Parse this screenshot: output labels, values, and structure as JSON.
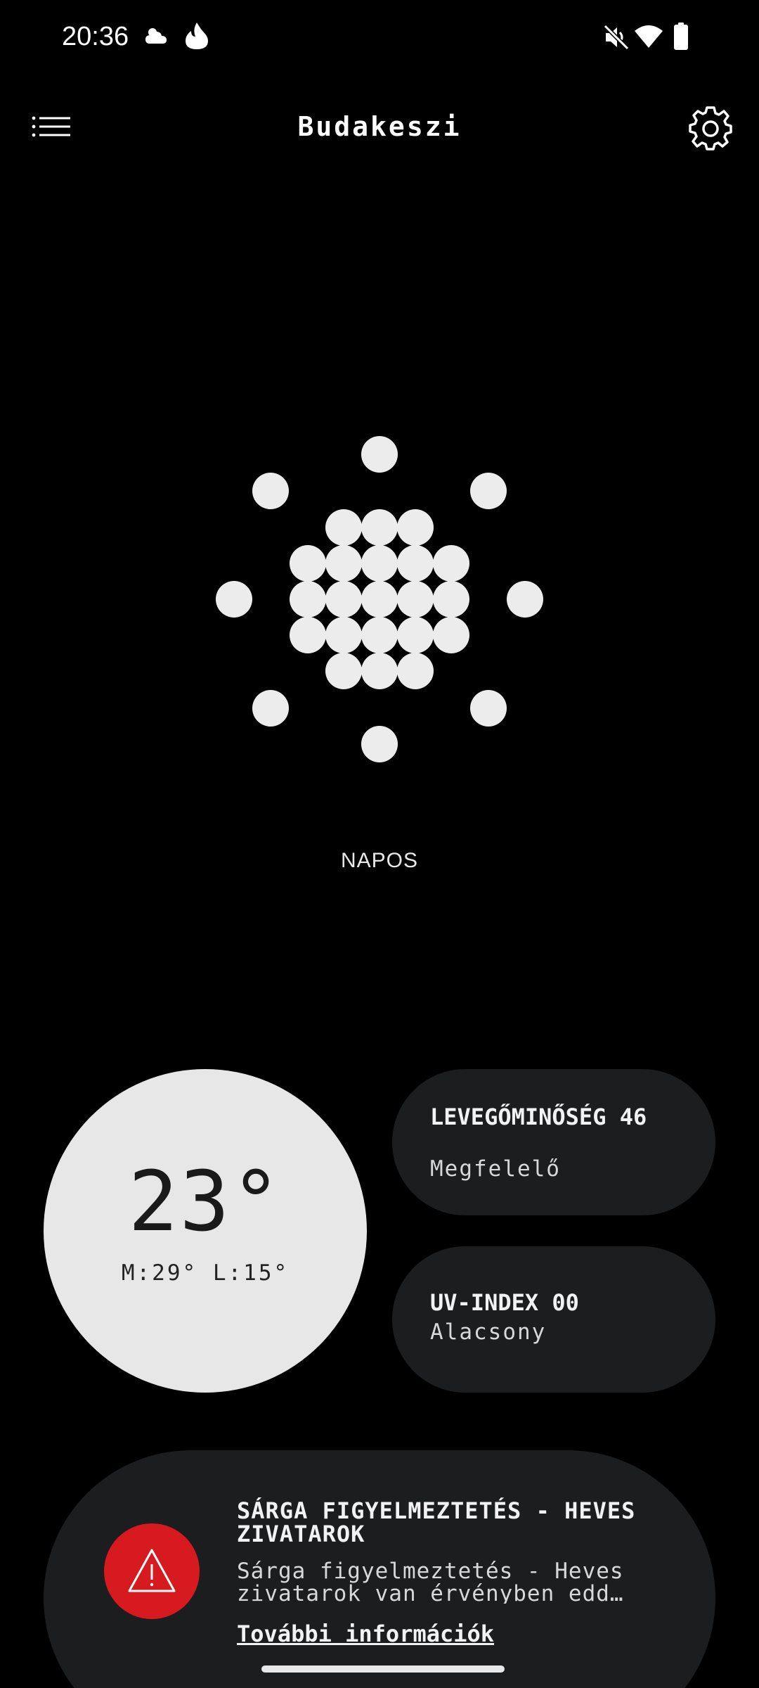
{
  "status_bar": {
    "time": "20:36",
    "left_icons": [
      "weather-cloudy-icon",
      "flame-icon"
    ],
    "right_icons": [
      "muted-speaker-icon",
      "wifi-icon",
      "battery-icon"
    ]
  },
  "header": {
    "city": "Budakeszi",
    "menu_icon": "menu-list-icon",
    "settings_icon": "gear-icon"
  },
  "weather": {
    "condition": "NAPOS",
    "illustration": "dotted-sun-icon"
  },
  "temperature": {
    "current": "23°",
    "range": "M:29° L:15°"
  },
  "air_quality": {
    "title": "LEVEGŐMINŐSÉG 46",
    "status": "Megfelelő"
  },
  "uv_index": {
    "title": "UV-INDEX 00",
    "status": "Alacsony"
  },
  "alert": {
    "title": "SÁRGA FIGYELMEZTETÉS - HEVES ZIVATAROK",
    "text": "Sárga figyelmeztetés - Heves zivatarok van érvényben edd…",
    "link": "További információk",
    "icon": "warning-triangle-icon",
    "color": "#d71920"
  },
  "colors": {
    "background": "#000000",
    "card": "#1c1d1f",
    "temp_circle": "#e6e7e6"
  }
}
